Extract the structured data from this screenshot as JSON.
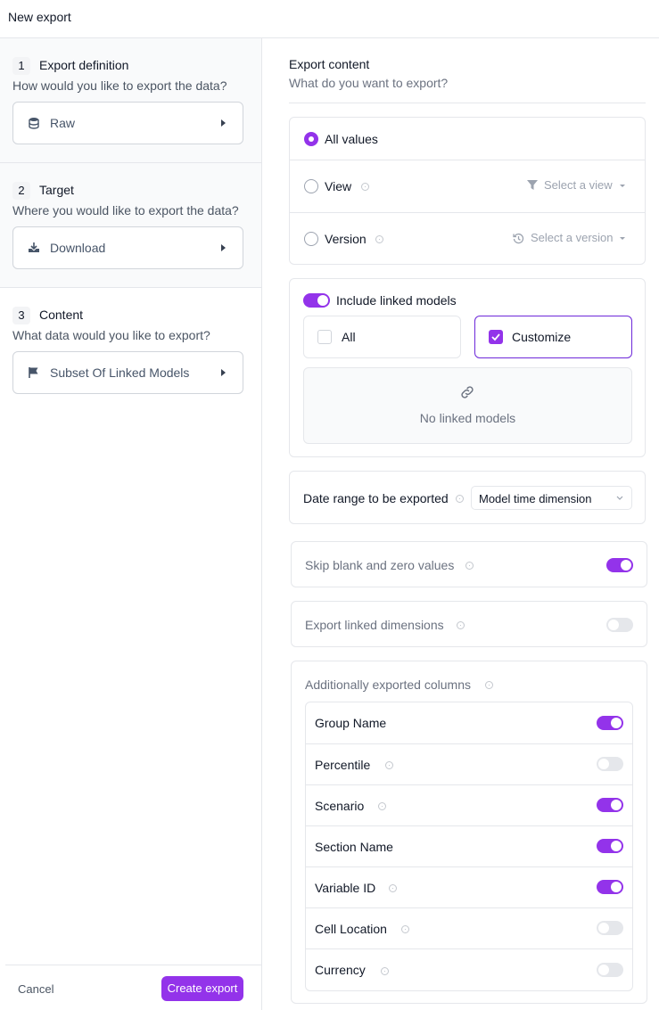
{
  "header": {
    "title": "New export"
  },
  "steps": [
    {
      "number": "1",
      "title": "Export definition",
      "subtitle": "How would you like to export the data?",
      "value": "Raw",
      "icon": "database-icon"
    },
    {
      "number": "2",
      "title": "Target",
      "subtitle": "Where you would like to export the data?",
      "value": "Download",
      "icon": "download-icon"
    },
    {
      "number": "3",
      "title": "Content",
      "subtitle": "What data would you like to export?",
      "value": "Subset Of Linked Models",
      "icon": "flag-icon"
    }
  ],
  "footer": {
    "cancel_label": "Cancel",
    "create_label": "Create export"
  },
  "content": {
    "heading": "Export content",
    "subheading": "What do you want to export?",
    "options": [
      {
        "label": "All values",
        "selected": true
      },
      {
        "label": "View",
        "selected": false,
        "picker": "Select a view"
      },
      {
        "label": "Version",
        "selected": false,
        "picker": "Select a version"
      }
    ],
    "linked": {
      "toggle_label": "Include linked models",
      "toggle_on": true,
      "all_label": "All",
      "customize_label": "Customize",
      "customize_checked": true,
      "empty_text": "No linked models"
    },
    "date_range": {
      "label": "Date range to be exported",
      "value": "Model time dimension"
    },
    "skip_blank": {
      "label": "Skip blank and zero values",
      "on": true
    },
    "export_linked_dims": {
      "label": "Export linked dimensions",
      "on": false
    },
    "extra_columns": {
      "title": "Additionally exported columns",
      "items": [
        {
          "label": "Group Name",
          "on": true,
          "info": false
        },
        {
          "label": "Percentile",
          "on": false,
          "info": true
        },
        {
          "label": "Scenario",
          "on": true,
          "info": true
        },
        {
          "label": "Section Name",
          "on": true,
          "info": false
        },
        {
          "label": "Variable ID",
          "on": true,
          "info": true
        },
        {
          "label": "Cell Location",
          "on": false,
          "info": true
        },
        {
          "label": "Currency",
          "on": false,
          "info": true
        }
      ]
    }
  },
  "colors": {
    "accent": "#9333ea",
    "border": "#e5e7eb"
  }
}
